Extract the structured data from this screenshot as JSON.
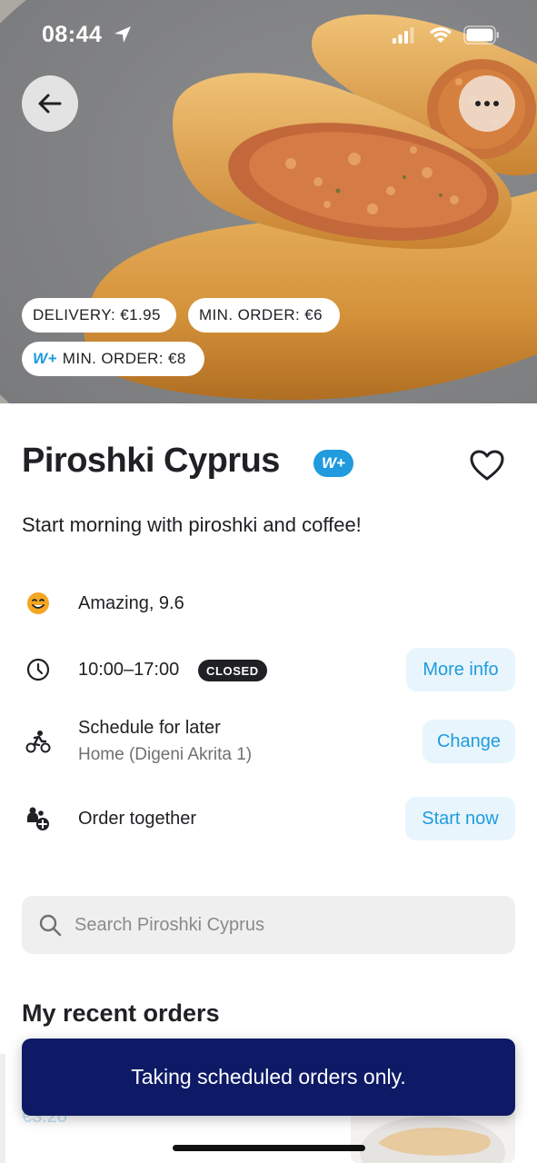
{
  "status_bar": {
    "time": "08:44",
    "icons": [
      "location-arrow-icon",
      "cellular-signal-icon",
      "wifi-icon",
      "battery-icon"
    ]
  },
  "hero": {
    "back_icon": "arrow-left-icon",
    "more_icon": "ellipsis-icon",
    "pills": {
      "delivery": "DELIVERY: €1.95",
      "min_order": "MIN. ORDER: €6",
      "wplus_prefix": "W+",
      "wplus_min_order": "MIN. ORDER: €8"
    }
  },
  "venue": {
    "name": "Piroshki Cyprus",
    "badge": "W+",
    "tagline": "Start morning with piroshki and coffee!",
    "favorite_icon": "heart-outline-icon"
  },
  "info": {
    "rating": {
      "icon": "smiley-icon",
      "text": "Amazing, 9.6"
    },
    "hours": {
      "icon": "clock-icon",
      "text": "10:00–17:00",
      "status": "CLOSED",
      "button": "More info"
    },
    "schedule": {
      "icon": "courier-bike-icon",
      "title": "Schedule for later",
      "address": "Home (Digeni Akrita 1)",
      "button": "Change"
    },
    "group": {
      "icon": "group-add-icon",
      "text": "Order together",
      "button": "Start now"
    }
  },
  "search": {
    "placeholder": "Search Piroshki Cyprus",
    "value": "",
    "icon": "search-icon"
  },
  "recent": {
    "title": "My recent orders",
    "peek_price": "€3.20"
  },
  "toast": {
    "text": "Taking scheduled orders only."
  },
  "colors": {
    "accent": "#1f9bde",
    "accent_bg": "#e8f5fc",
    "toast_bg": "#0e1a66",
    "text": "#202125"
  }
}
